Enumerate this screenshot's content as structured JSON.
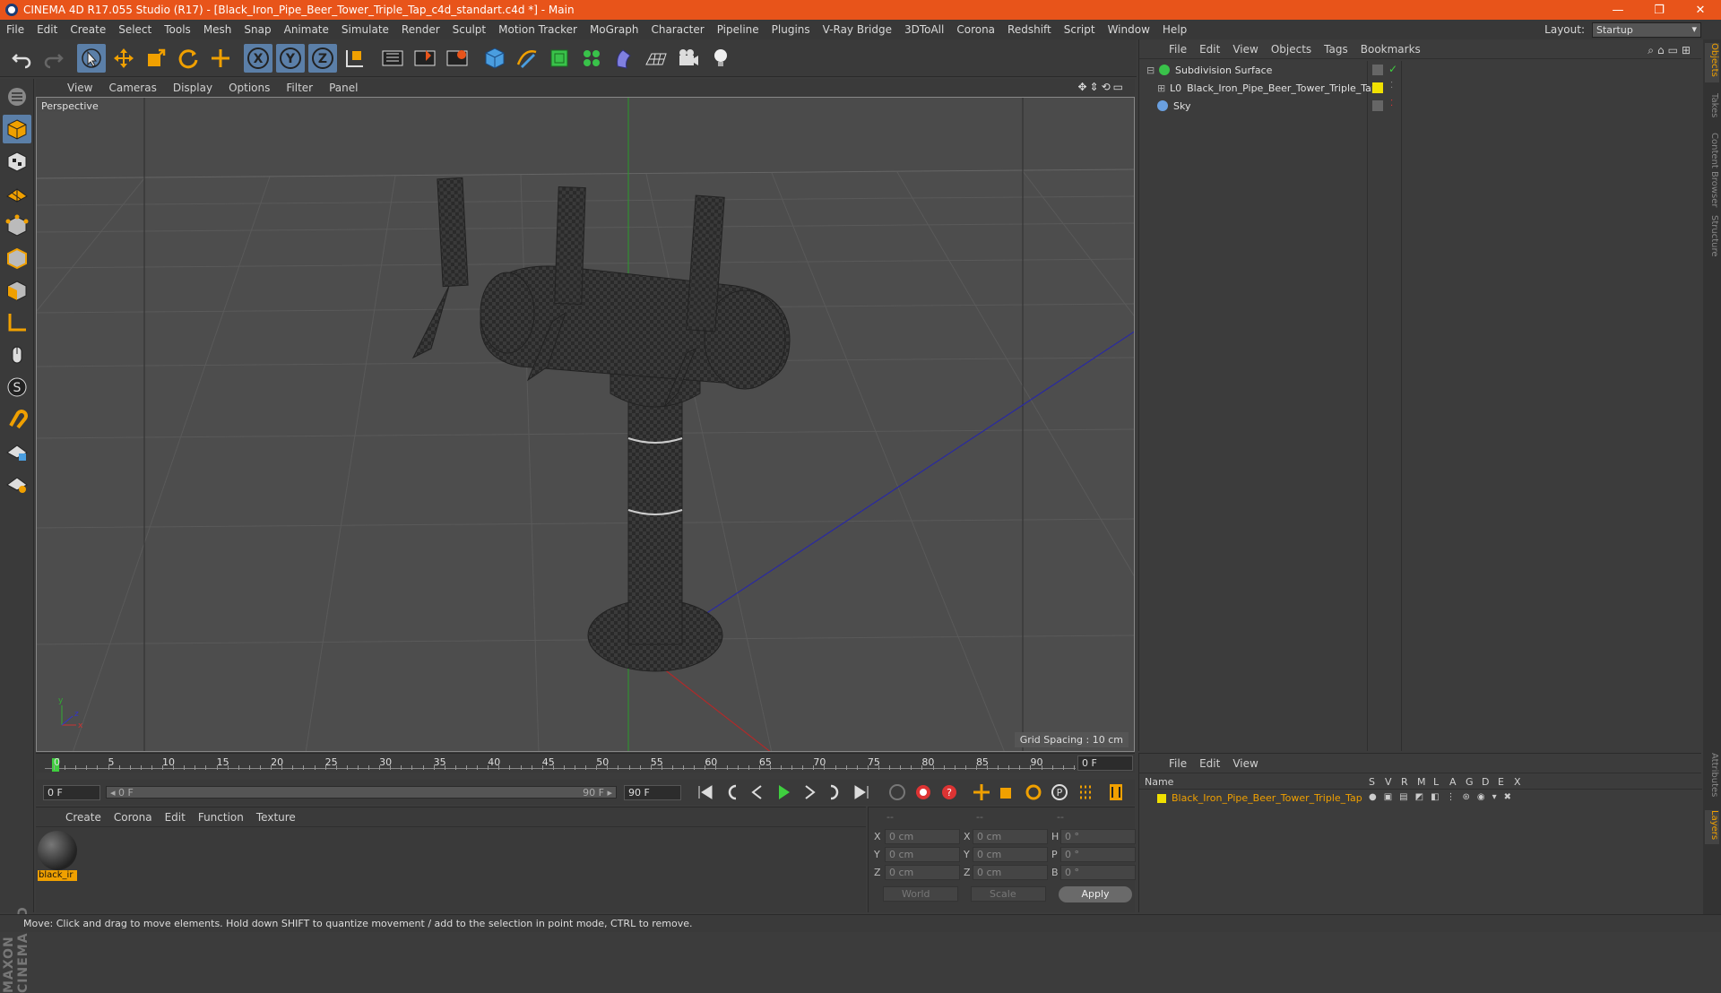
{
  "window": {
    "title": "CINEMA 4D R17.055 Studio (R17) - [Black_Iron_Pipe_Beer_Tower_Triple_Tap_c4d_standart.c4d *] - Main",
    "controls": {
      "minimize": "—",
      "restore": "❐",
      "close": "✕"
    }
  },
  "menubar": {
    "items": [
      "File",
      "Edit",
      "Create",
      "Select",
      "Tools",
      "Mesh",
      "Snap",
      "Animate",
      "Simulate",
      "Render",
      "Sculpt",
      "Motion Tracker",
      "MoGraph",
      "Character",
      "Pipeline",
      "Plugins",
      "V-Ray Bridge",
      "3DToAll",
      "Corona",
      "Redshift",
      "Script",
      "Window",
      "Help"
    ],
    "layout_label": "Layout:",
    "layout_value": "Startup"
  },
  "toolbar": {
    "icons": [
      "undo-icon",
      "redo-icon",
      "live-selection-icon",
      "move-icon",
      "scale-icon",
      "rotate-icon",
      "create-object-icon",
      "x-axis-icon",
      "y-axis-icon",
      "z-axis-icon",
      "world-coordinates-icon",
      "render-view-icon",
      "render-picture-viewer-icon",
      "edit-render-settings-icon",
      "cube-icon",
      "pen-icon",
      "subdivision-icon",
      "cloner-icon",
      "deformer-icon",
      "floor-icon",
      "camera-icon",
      "light-icon"
    ],
    "axis_labels": {
      "x": "X",
      "y": "Y",
      "z": "Z"
    }
  },
  "viewport": {
    "menu": [
      "View",
      "Cameras",
      "Display",
      "Options",
      "Filter",
      "Panel"
    ],
    "label": "Perspective",
    "grid_spacing": "Grid Spacing : 10 cm",
    "axis_labels": {
      "y": "y",
      "x": "x",
      "z": "z"
    }
  },
  "timeline": {
    "ticks": [
      "0",
      "5",
      "10",
      "15",
      "20",
      "25",
      "30",
      "35",
      "40",
      "45",
      "50",
      "55",
      "60",
      "65",
      "70",
      "75",
      "80",
      "85",
      "90"
    ],
    "current_frame": "0 F",
    "start_field": "0 F",
    "slider_left": "◂ 0 F",
    "slider_right": "90 F ▸",
    "end_field": "90 F"
  },
  "material_manager": {
    "menu": [
      "Create",
      "Corona",
      "Edit",
      "Function",
      "Texture"
    ],
    "materials": [
      {
        "name": "black_ir"
      }
    ]
  },
  "coordinates": {
    "headers": [
      "--",
      "--",
      "--"
    ],
    "rows": [
      {
        "a": "X",
        "av": "0 cm",
        "b": "X",
        "bv": "0 cm",
        "c": "H",
        "cv": "0 °"
      },
      {
        "a": "Y",
        "av": "0 cm",
        "b": "Y",
        "bv": "0 cm",
        "c": "P",
        "cv": "0 °"
      },
      {
        "a": "Z",
        "av": "0 cm",
        "b": "Z",
        "bv": "0 cm",
        "c": "B",
        "cv": "0 °"
      }
    ],
    "mode": "World",
    "transform": "Scale",
    "apply": "Apply"
  },
  "object_manager": {
    "menu": [
      "File",
      "Edit",
      "View",
      "Objects",
      "Tags",
      "Bookmarks"
    ],
    "objects": [
      {
        "name": "Subdivision Surface",
        "color": "#39c24a"
      },
      {
        "name": "Black_Iron_Pipe_Beer_Tower_Triple_Tap",
        "color": "#cccccc"
      },
      {
        "name": "Sky",
        "color": "#6aa0e0"
      }
    ]
  },
  "side_tabs": [
    "Objects",
    "Takes",
    "Content Browser",
    "Structure",
    "Attributes",
    "Layers"
  ],
  "layer_manager": {
    "menu": [
      "File",
      "Edit",
      "View"
    ],
    "columns": [
      "Name",
      "S",
      "V",
      "R",
      "M",
      "L",
      "A",
      "G",
      "D",
      "E",
      "X"
    ],
    "layer_name": "Black_Iron_Pipe_Beer_Tower_Triple_Tap"
  },
  "status": "Move: Click and drag to move elements. Hold down SHIFT to quantize movement / add to the selection in point mode, CTRL to remove."
}
